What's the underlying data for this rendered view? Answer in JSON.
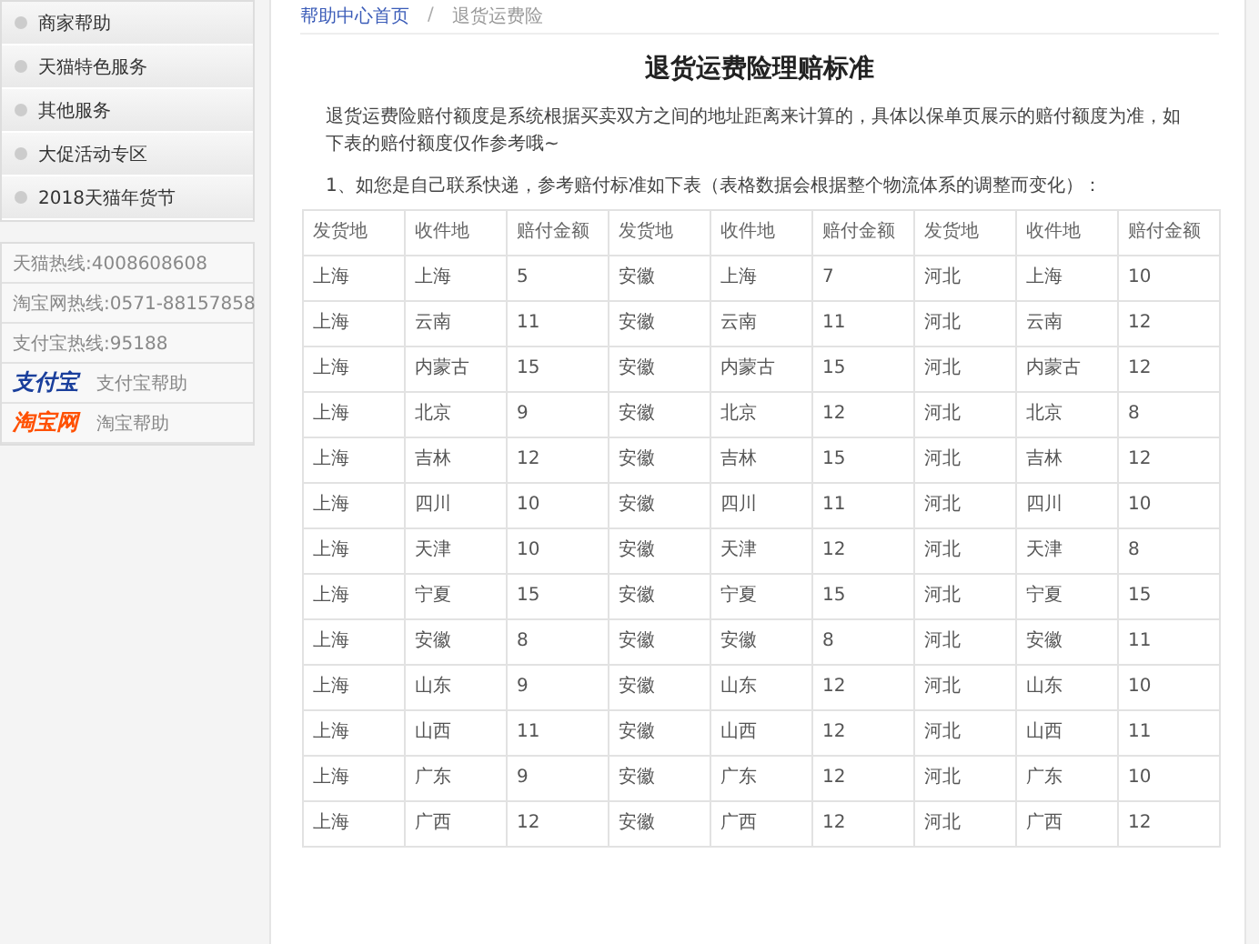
{
  "sidebar": {
    "menu": [
      {
        "label": "商家帮助"
      },
      {
        "label": "天猫特色服务"
      },
      {
        "label": "其他服务"
      },
      {
        "label": "大促活动专区"
      },
      {
        "label": "2018天猫年货节"
      }
    ],
    "contacts": [
      {
        "kind": "text",
        "label": "天猫热线:4008608608"
      },
      {
        "kind": "text",
        "label": "淘宝网热线:0571-88157858"
      },
      {
        "kind": "text",
        "label": "支付宝热线:95188"
      },
      {
        "kind": "logo",
        "logo": "支付宝",
        "label": "支付宝帮助",
        "color": "#1a3f9c"
      },
      {
        "kind": "logo",
        "logo": "淘宝网",
        "label": "淘宝帮助",
        "color": "#ff5000"
      }
    ]
  },
  "breadcrumb": {
    "home": "帮助中心首页",
    "separator": "/",
    "current": "退货运费险"
  },
  "article": {
    "title": "退货运费险理赔标准",
    "intro": "退货运费险赔付额度是系统根据买卖双方之间的地址距离来计算的，具体以保单页展示的赔付额度为准，如下表的赔付额度仅作参考哦~",
    "note": "1、如您是自己联系快递，参考赔付标准如下表（表格数据会根据整个物流体系的调整而变化）："
  },
  "table": {
    "columns": [
      "发货地",
      "收件地",
      "赔付金额",
      "发货地",
      "收件地",
      "赔付金额",
      "发货地",
      "收件地",
      "赔付金额"
    ],
    "rows": [
      [
        "上海",
        "上海",
        "5",
        "安徽",
        "上海",
        "7",
        "河北",
        "上海",
        "10"
      ],
      [
        "上海",
        "云南",
        "11",
        "安徽",
        "云南",
        "11",
        "河北",
        "云南",
        "12"
      ],
      [
        "上海",
        "内蒙古",
        "15",
        "安徽",
        "内蒙古",
        "15",
        "河北",
        "内蒙古",
        "12"
      ],
      [
        "上海",
        "北京",
        "9",
        "安徽",
        "北京",
        "12",
        "河北",
        "北京",
        "8"
      ],
      [
        "上海",
        "吉林",
        "12",
        "安徽",
        "吉林",
        "15",
        "河北",
        "吉林",
        "12"
      ],
      [
        "上海",
        "四川",
        "10",
        "安徽",
        "四川",
        "11",
        "河北",
        "四川",
        "10"
      ],
      [
        "上海",
        "天津",
        "10",
        "安徽",
        "天津",
        "12",
        "河北",
        "天津",
        "8"
      ],
      [
        "上海",
        "宁夏",
        "15",
        "安徽",
        "宁夏",
        "15",
        "河北",
        "宁夏",
        "15"
      ],
      [
        "上海",
        "安徽",
        "8",
        "安徽",
        "安徽",
        "8",
        "河北",
        "安徽",
        "11"
      ],
      [
        "上海",
        "山东",
        "9",
        "安徽",
        "山东",
        "12",
        "河北",
        "山东",
        "10"
      ],
      [
        "上海",
        "山西",
        "11",
        "安徽",
        "山西",
        "12",
        "河北",
        "山西",
        "11"
      ],
      [
        "上海",
        "广东",
        "9",
        "安徽",
        "广东",
        "12",
        "河北",
        "广东",
        "10"
      ],
      [
        "上海",
        "广西",
        "12",
        "安徽",
        "广西",
        "12",
        "河北",
        "广西",
        "12"
      ]
    ]
  }
}
